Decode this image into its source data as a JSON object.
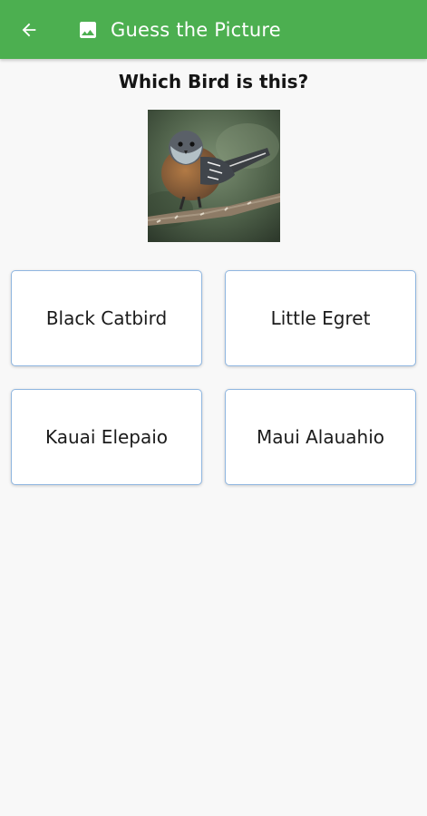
{
  "app_bar": {
    "title": "Guess the Picture",
    "back_icon": "arrow-left-icon",
    "title_icon": "image-icon",
    "color": "#4caf50"
  },
  "question": {
    "text": "Which Bird is this?",
    "image": "bird-photo"
  },
  "answers": [
    {
      "label": "Black Catbird"
    },
    {
      "label": "Little Egret"
    },
    {
      "label": "Kauai Elepaio"
    },
    {
      "label": "Maui Alauahio"
    }
  ]
}
